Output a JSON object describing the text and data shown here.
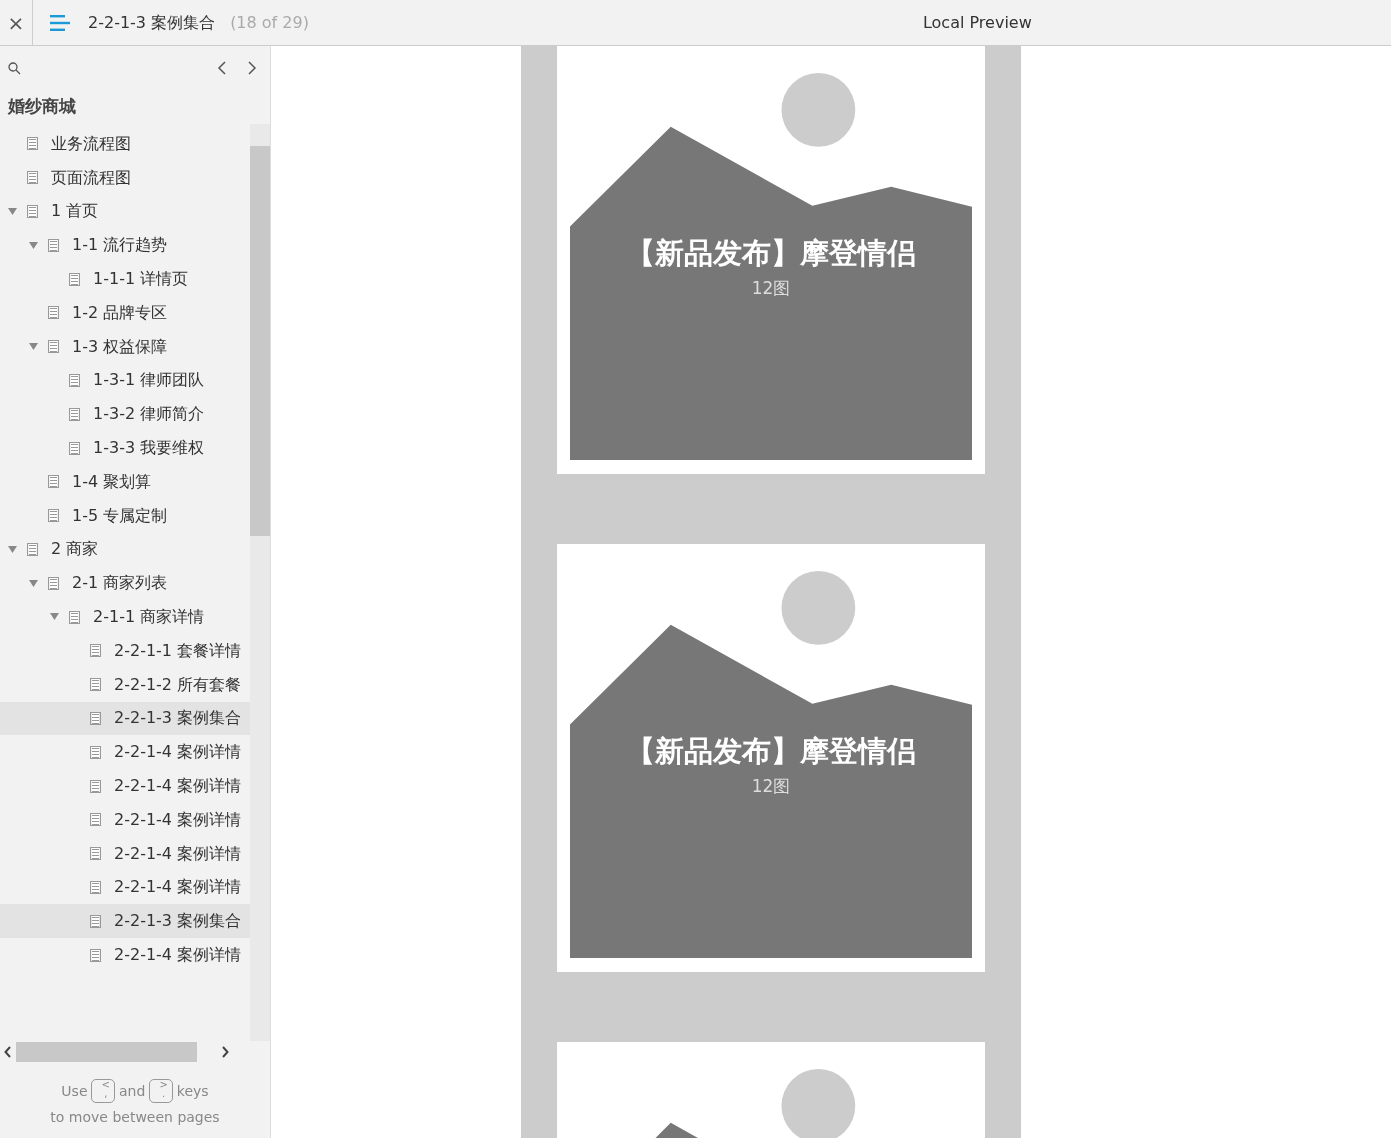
{
  "toolbar": {
    "close": "×",
    "page_title": "2-2-1-3 案例集合",
    "page_count": "(18 of 29)",
    "preview_label": "Local Preview"
  },
  "sidebar": {
    "project_title": "婚纱商城",
    "pages": [
      {
        "label": "业务流程图",
        "selected": false
      },
      {
        "label": "页面流程图",
        "selected": false
      },
      {
        "label": "1 首页",
        "selected": false,
        "expanded": true,
        "children": [
          {
            "label": "1-1 流行趋势",
            "selected": false,
            "expanded": true,
            "children": [
              {
                "label": "1-1-1 详情页",
                "selected": false
              }
            ]
          },
          {
            "label": "1-2 品牌专区",
            "selected": false
          },
          {
            "label": "1-3 权益保障",
            "selected": false,
            "expanded": true,
            "children": [
              {
                "label": "1-3-1 律师团队",
                "selected": false
              },
              {
                "label": "1-3-2 律师简介",
                "selected": false
              },
              {
                "label": "1-3-3 我要维权",
                "selected": false
              }
            ]
          },
          {
            "label": "1-4 聚划算",
            "selected": false
          },
          {
            "label": "1-5 专属定制",
            "selected": false
          }
        ]
      },
      {
        "label": "2 商家",
        "selected": false,
        "expanded": true,
        "children": [
          {
            "label": "2-1 商家列表",
            "selected": false,
            "expanded": true,
            "children": [
              {
                "label": "2-1-1 商家详情",
                "selected": false,
                "expanded": true,
                "children": [
                  {
                    "label": "2-2-1-1 套餐详情",
                    "selected": false
                  },
                  {
                    "label": "2-2-1-2 所有套餐",
                    "selected": false
                  },
                  {
                    "label": "2-2-1-3 案例集合",
                    "selected": true
                  },
                  {
                    "label": "2-2-1-4 案例详情",
                    "selected": false
                  },
                  {
                    "label": "2-2-1-4 案例详情",
                    "selected": false
                  },
                  {
                    "label": "2-2-1-4 案例详情",
                    "selected": false
                  },
                  {
                    "label": "2-2-1-4 案例详情",
                    "selected": false
                  },
                  {
                    "label": "2-2-1-4 案例详情",
                    "selected": false
                  },
                  {
                    "label": "2-2-1-3 案例集合",
                    "selected": true
                  },
                  {
                    "label": "2-2-1-4 案例详情",
                    "selected": false
                  }
                ]
              }
            ]
          }
        ]
      }
    ],
    "hint_use": "Use",
    "key_prev": "<\n,",
    "hint_and": "and",
    "key_next": ">\n.",
    "hint_keys": "keys",
    "hint_line2": "to move between pages"
  },
  "cards": [
    {
      "kind": "captioned",
      "title": "【新品发布】摩登情侣",
      "subtitle": "12图"
    },
    {
      "kind": "captioned",
      "title": "【新品发布】摩登情侣",
      "subtitle": "12图"
    },
    {
      "kind": "plain"
    }
  ]
}
